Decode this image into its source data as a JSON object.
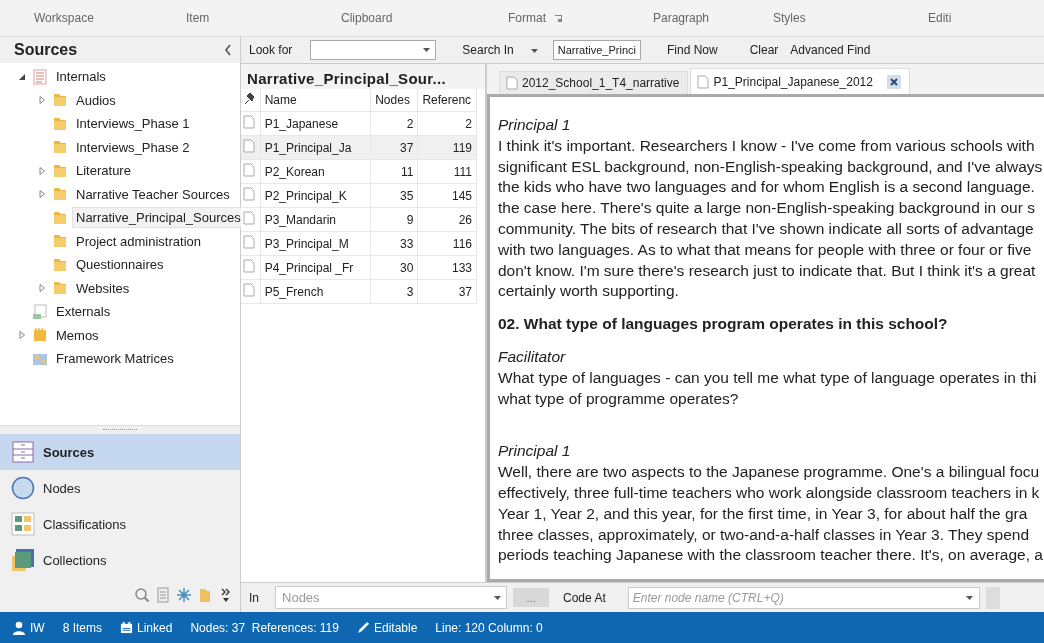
{
  "ribbon_groups": [
    {
      "label": "Workspace",
      "launcher": false
    },
    {
      "label": "Item",
      "launcher": false
    },
    {
      "label": "Clipboard",
      "launcher": false
    },
    {
      "label": "Format",
      "launcher": true
    },
    {
      "label": "Paragraph",
      "launcher": false
    },
    {
      "label": "Styles",
      "launcher": false
    },
    {
      "label": "Editi",
      "launcher": false
    }
  ],
  "find_bar": {
    "look_for_label": "Look for",
    "search_in_label": "Search In",
    "search_in_value": "Narrative_Princi",
    "find_now": "Find Now",
    "clear": "Clear",
    "advanced_find": "Advanced Find"
  },
  "sidebar": {
    "title": "Sources",
    "tree": [
      {
        "label": "Internals",
        "kind": "internals",
        "expanded": true,
        "selected": false,
        "children": [
          {
            "label": "Audios",
            "kind": "folder",
            "expanded": false,
            "selected": false
          },
          {
            "label": "Interviews_Phase 1",
            "kind": "folder",
            "selected": false
          },
          {
            "label": "Interviews_Phase 2",
            "kind": "folder",
            "selected": false
          },
          {
            "label": "Literature",
            "kind": "folder",
            "expanded": false,
            "selected": false
          },
          {
            "label": "Narrative Teacher Sources",
            "kind": "folder",
            "expanded": false,
            "selected": false
          },
          {
            "label": "Narrative_Principal_Sources",
            "kind": "folder",
            "selected": true
          },
          {
            "label": "Project administration",
            "kind": "folder",
            "selected": false
          },
          {
            "label": "Questionnaires",
            "kind": "folder",
            "selected": false
          },
          {
            "label": "Websites",
            "kind": "folder",
            "expanded": false,
            "selected": false
          }
        ]
      },
      {
        "label": "Externals",
        "kind": "externals",
        "selected": false
      },
      {
        "label": "Memos",
        "kind": "memos",
        "expanded": false,
        "selected": false
      },
      {
        "label": "Framework Matrices",
        "kind": "matrices",
        "selected": false
      }
    ],
    "navigation": [
      {
        "label": "Sources",
        "kind": "sources",
        "selected": true
      },
      {
        "label": "Nodes",
        "kind": "nodes",
        "selected": false
      },
      {
        "label": "Classifications",
        "kind": "classifications",
        "selected": false
      },
      {
        "label": "Collections",
        "kind": "collections",
        "selected": false
      }
    ]
  },
  "list_view": {
    "title": "Narrative_Principal_Sour...",
    "columns": [
      "Name",
      "Nodes",
      "Referenc"
    ],
    "rows": [
      {
        "name": "P1_Japanese",
        "nodes": "2",
        "references": "2",
        "selected": false
      },
      {
        "name": "P1_Principal_Ja",
        "nodes": "37",
        "references": "119",
        "selected": true
      },
      {
        "name": "P2_Korean",
        "nodes": "11",
        "references": "111",
        "selected": false
      },
      {
        "name": "P2_Principal_K",
        "nodes": "35",
        "references": "145",
        "selected": false
      },
      {
        "name": "P3_Mandarin",
        "nodes": "9",
        "references": "26",
        "selected": false
      },
      {
        "name": "P3_Principal_M",
        "nodes": "33",
        "references": "116",
        "selected": false
      },
      {
        "name": "P4_Principal _Fr",
        "nodes": "30",
        "references": "133",
        "selected": false
      },
      {
        "name": "P5_French",
        "nodes": "3",
        "references": "37",
        "selected": false
      }
    ]
  },
  "document": {
    "tabs": [
      {
        "label": "2012_School_1_T4_narrative",
        "selected": false
      },
      {
        "label": "P1_Principal_Japanese_2012",
        "selected": true
      }
    ],
    "blocks": [
      {
        "kind": "speaker",
        "lines": [
          "Principal 1"
        ]
      },
      {
        "kind": "text",
        "lines": [
          "I think it's important. Researchers I know - I've come from various schools with",
          "significant ESL background, non-English-speaking background, and I've always",
          "the kids who have two languages and for whom English is a second language.",
          "the case here. There's quite a large non-English-speaking background in our s",
          "community. The bits of research that I've shown indicate all sorts of advantage",
          "with two languages. As to what that means for people with three or four or five",
          "don't know. I'm sure there's research just to indicate that. But I think it's a great",
          "certainly worth supporting."
        ]
      },
      {
        "kind": "heading",
        "lines": [
          "02. What type of languages program operates in this school?"
        ]
      },
      {
        "kind": "speaker",
        "lines": [
          "Facilitator"
        ]
      },
      {
        "kind": "text",
        "lines": [
          "What type of languages - can you tell me what type of language operates in thi",
          "what type of programme operates?"
        ]
      },
      {
        "kind": "gap"
      },
      {
        "kind": "speaker",
        "lines": [
          "Principal 1"
        ]
      },
      {
        "kind": "text",
        "lines": [
          "Well, there are two aspects to the Japanese programme. One's a bilingual focu",
          "effectively, three full-time teachers who work alongside classroom teachers in k",
          "Year 1, Year 2, and this year, for the first time, in Year 3, for about half the gra",
          "three classes, approximately, or two-and-a-half classes in Year 3. They spend",
          "periods teaching Japanese with the classroom teacher there. It's, on average, a"
        ]
      }
    ]
  },
  "coding_bar": {
    "in_label": "In",
    "in_value": "Nodes",
    "browse": "...",
    "code_at_label": "Code At",
    "code_at_placeholder": "Enter node name (CTRL+Q)"
  },
  "status_bar": {
    "user": "IW",
    "items": "8 Items",
    "linked": "Linked",
    "counts": "Nodes: 37  References: 119",
    "mode": "Editable",
    "position": "Line: 120 Column: 0"
  }
}
